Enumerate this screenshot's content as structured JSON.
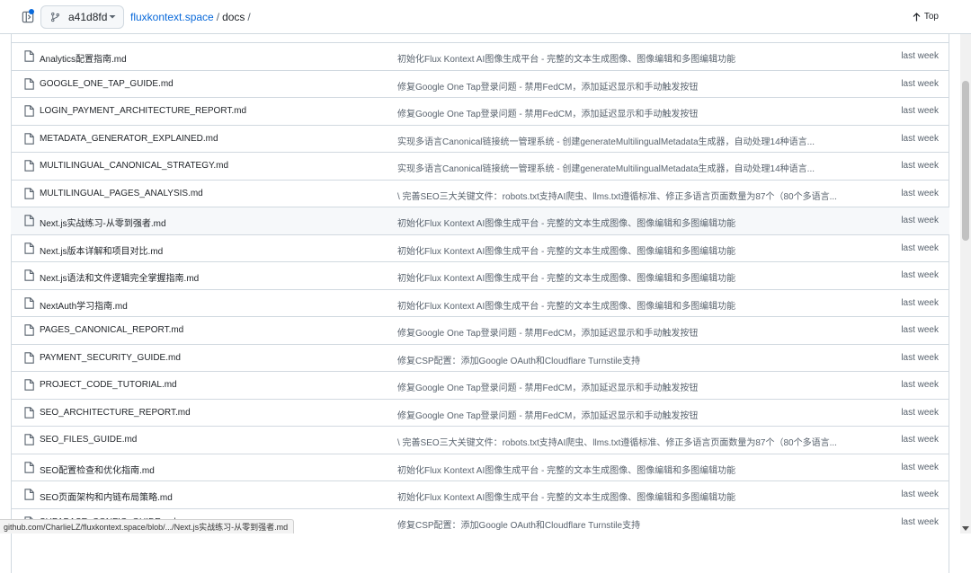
{
  "header": {
    "branch": "a41d8fd",
    "repo": "fluxkontext.space",
    "separator": "/",
    "dir": "docs",
    "dir_separator": "/",
    "top_label": "Top"
  },
  "files": [
    {
      "name": "Analytics配置指南.md",
      "message": "初始化Flux Kontext AI图像生成平台 - 完整的文本生成图像、图像编辑和多图编辑功能",
      "date": "last week"
    },
    {
      "name": "GOOGLE_ONE_TAP_GUIDE.md",
      "message": "修复Google One Tap登录问题 - 禁用FedCM，添加延迟显示和手动触发按钮",
      "date": "last week"
    },
    {
      "name": "LOGIN_PAYMENT_ARCHITECTURE_REPORT.md",
      "message": "修复Google One Tap登录问题 - 禁用FedCM，添加延迟显示和手动触发按钮",
      "date": "last week"
    },
    {
      "name": "METADATA_GENERATOR_EXPLAINED.md",
      "message": "实现多语言Canonical链接统一管理系统 - 创建generateMultilingualMetadata生成器，自动处理14种语言...",
      "date": "last week"
    },
    {
      "name": "MULTILINGUAL_CANONICAL_STRATEGY.md",
      "message": "实现多语言Canonical链接统一管理系统 - 创建generateMultilingualMetadata生成器，自动处理14种语言...",
      "date": "last week"
    },
    {
      "name": "MULTILINGUAL_PAGES_ANALYSIS.md",
      "message": "\\ 完善SEO三大关键文件：robots.txt支持AI爬虫、llms.txt遵循标准、修正多语言页面数量为87个（80个多语言...",
      "date": "last week"
    },
    {
      "name": "Next.js实战练习-从零到强者.md",
      "message": "初始化Flux Kontext AI图像生成平台 - 完整的文本生成图像、图像编辑和多图编辑功能",
      "date": "last week",
      "hovered": true
    },
    {
      "name": "Next.js版本详解和项目对比.md",
      "message": "初始化Flux Kontext AI图像生成平台 - 完整的文本生成图像、图像编辑和多图编辑功能",
      "date": "last week"
    },
    {
      "name": "Next.js语法和文件逻辑完全掌握指南.md",
      "message": "初始化Flux Kontext AI图像生成平台 - 完整的文本生成图像、图像编辑和多图编辑功能",
      "date": "last week"
    },
    {
      "name": "NextAuth学习指南.md",
      "message": "初始化Flux Kontext AI图像生成平台 - 完整的文本生成图像、图像编辑和多图编辑功能",
      "date": "last week"
    },
    {
      "name": "PAGES_CANONICAL_REPORT.md",
      "message": "修复Google One Tap登录问题 - 禁用FedCM，添加延迟显示和手动触发按钮",
      "date": "last week"
    },
    {
      "name": "PAYMENT_SECURITY_GUIDE.md",
      "message": "修复CSP配置：添加Google OAuth和Cloudflare Turnstile支持",
      "date": "last week"
    },
    {
      "name": "PROJECT_CODE_TUTORIAL.md",
      "message": "修复Google One Tap登录问题 - 禁用FedCM，添加延迟显示和手动触发按钮",
      "date": "last week"
    },
    {
      "name": "SEO_ARCHITECTURE_REPORT.md",
      "message": "修复Google One Tap登录问题 - 禁用FedCM，添加延迟显示和手动触发按钮",
      "date": "last week"
    },
    {
      "name": "SEO_FILES_GUIDE.md",
      "message": "\\ 完善SEO三大关键文件：robots.txt支持AI爬虫、llms.txt遵循标准、修正多语言页面数量为87个（80个多语言...",
      "date": "last week"
    },
    {
      "name": "SEO配置检查和优化指南.md",
      "message": "初始化Flux Kontext AI图像生成平台 - 完整的文本生成图像、图像编辑和多图编辑功能",
      "date": "last week"
    },
    {
      "name": "SEO页面架构和内链布局策略.md",
      "message": "初始化Flux Kontext AI图像生成平台 - 完整的文本生成图像、图像编辑和多图编辑功能",
      "date": "last week"
    },
    {
      "name": "SUPABASE_CONFIG_GUIDE.md",
      "message": "修复CSP配置：添加Google OAuth和Cloudflare Turnstile支持",
      "date": "last week"
    }
  ],
  "status_url": "github.com/CharlieLZ/fluxkontext.space/blob/.../Next.js实战练习-从零到强者.md",
  "colors": {
    "link": "#0969da",
    "muted": "#59636e",
    "border": "#d1d9e0",
    "hover_row": "#f6f8fa"
  }
}
